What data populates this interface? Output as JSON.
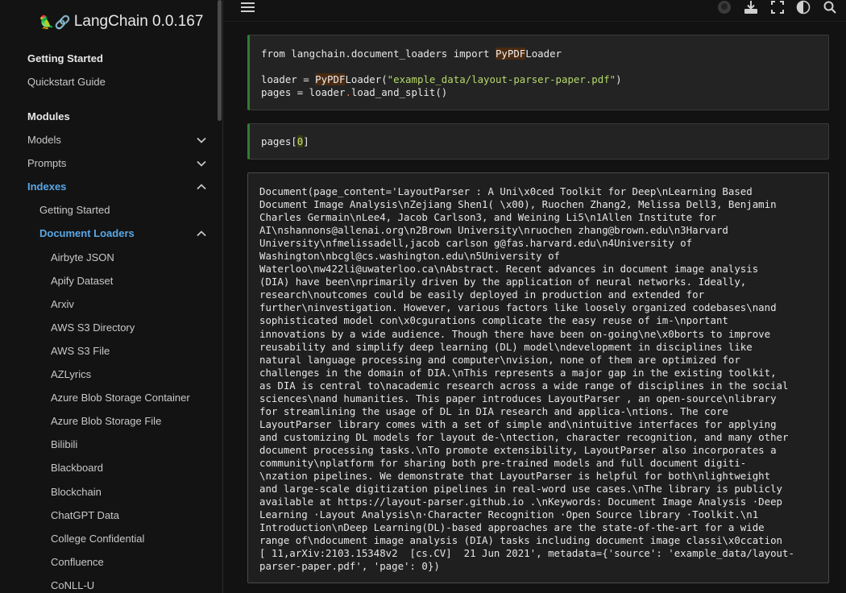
{
  "sidebar": {
    "brand_emoji": "🦜🔗",
    "brand_title": "LangChain 0.0.167",
    "sections": [
      {
        "caption": "Getting Started",
        "items": [
          {
            "label": "Quickstart Guide"
          }
        ]
      },
      {
        "caption": "Modules",
        "items": [
          {
            "label": "Models",
            "expanded": false
          },
          {
            "label": "Prompts",
            "expanded": false
          },
          {
            "label": "Indexes",
            "expanded": true,
            "active": true
          }
        ]
      }
    ],
    "indexes_children": [
      {
        "label": "Getting Started"
      },
      {
        "label": "Document Loaders",
        "expanded": true,
        "active": true
      }
    ],
    "document_loaders": [
      "Airbyte JSON",
      "Apify Dataset",
      "Arxiv",
      "AWS S3 Directory",
      "AWS S3 File",
      "AZLyrics",
      "Azure Blob Storage Container",
      "Azure Blob Storage File",
      "Bilibili",
      "Blackboard",
      "Blockchain",
      "ChatGPT Data",
      "College Confidential",
      "Confluence",
      "CoNLL-U"
    ]
  },
  "topbar": {
    "icons": [
      "menu-icon",
      "github-icon",
      "download-icon",
      "fullscreen-icon",
      "theme-toggle-icon",
      "search-icon"
    ]
  },
  "cells": {
    "cell1": {
      "line1_pre": "from langchain.document_loaders import ",
      "line1_cls": "PyPDF",
      "line1_post": "Loader",
      "line3_pre": "loader = ",
      "line3_cls": "PyPDF",
      "line3_mid": "Loader(",
      "line3_str": "\"example_data/layout-parser-paper.pdf\"",
      "line3_end": ")",
      "line4_pre": "pages = loader",
      "line4_dot": ".",
      "line4_post": "load_and_split()"
    },
    "cell2": {
      "pre": "pages[",
      "num": "0",
      "post": "]"
    },
    "output": {
      "lines": [
        "Document(page_content='LayoutParser : A Uni\\x0ced Toolkit for Deep\\nLearning Based",
        "Document Image Analysis\\nZejiang Shen1( \\x00), Ruochen Zhang2, Melissa Dell3, Benjamin",
        "Charles Germain\\nLee4, Jacob Carlson3, and Weining Li5\\n1Allen Institute for",
        "AI\\nshannons@allenai.org\\n2Brown University\\nruochen zhang@brown.edu\\n3Harvard",
        "University\\nfmelissadell,jacob carlson g@fas.harvard.edu\\n4University of",
        "Washington\\nbcgl@cs.washington.edu\\n5University of",
        "Waterloo\\nw422li@uwaterloo.ca\\nAbstract. Recent advances in document image analysis",
        "(DIA) have been\\nprimarily driven by the application of neural networks. Ideally,",
        "research\\noutcomes could be easily deployed in production and extended for",
        "further\\ninvestigation. However, various factors like loosely organized codebases\\nand",
        "sophisticated model con\\x0cgurations complicate the easy reuse of im-\\nportant",
        "innovations by a wide audience. Though there have been on-going\\ne\\x0borts to improve",
        "reusability and simplify deep learning (DL) model\\ndevelopment in disciplines like",
        "natural language processing and computer\\nvision, none of them are optimized for",
        "challenges in the domain of DIA.\\nThis represents a major gap in the existing toolkit,",
        "as DIA is central to\\nacademic research across a wide range of disciplines in the social",
        "sciences\\nand humanities. This paper introduces LayoutParser , an open-source\\nlibrary",
        "for streamlining the usage of DL in DIA research and applica-\\ntions. The core",
        "LayoutParser library comes with a set of simple and\\nintuitive interfaces for applying",
        "and customizing DL models for layout de-\\ntection, character recognition, and many other",
        "document processing tasks.\\nTo promote extensibility, LayoutParser also incorporates a",
        "community\\nplatform for sharing both pre-trained models and full document digiti-",
        "\\nzation pipelines. We demonstrate that LayoutParser is helpful for both\\nlightweight",
        "and large-scale digitization pipelines in real-word use cases.\\nThe library is publicly",
        "available at https://layout-parser.github.io .\\nKeywords: Document Image Analysis ·Deep",
        "Learning ·Layout Analysis\\n·Character Recognition ·Open Source library ·Toolkit.\\n1",
        "Introduction\\nDeep Learning(DL)-based approaches are the state-of-the-art for a wide",
        "range of\\ndocument image analysis (DIA) tasks including document image classi\\x0ccation",
        "[ 11,arXiv:2103.15348v2  [cs.CV]  21 Jun 2021', metadata={'source': 'example_data/layout-",
        "parser-paper.pdf', 'page': 0})"
      ]
    }
  }
}
